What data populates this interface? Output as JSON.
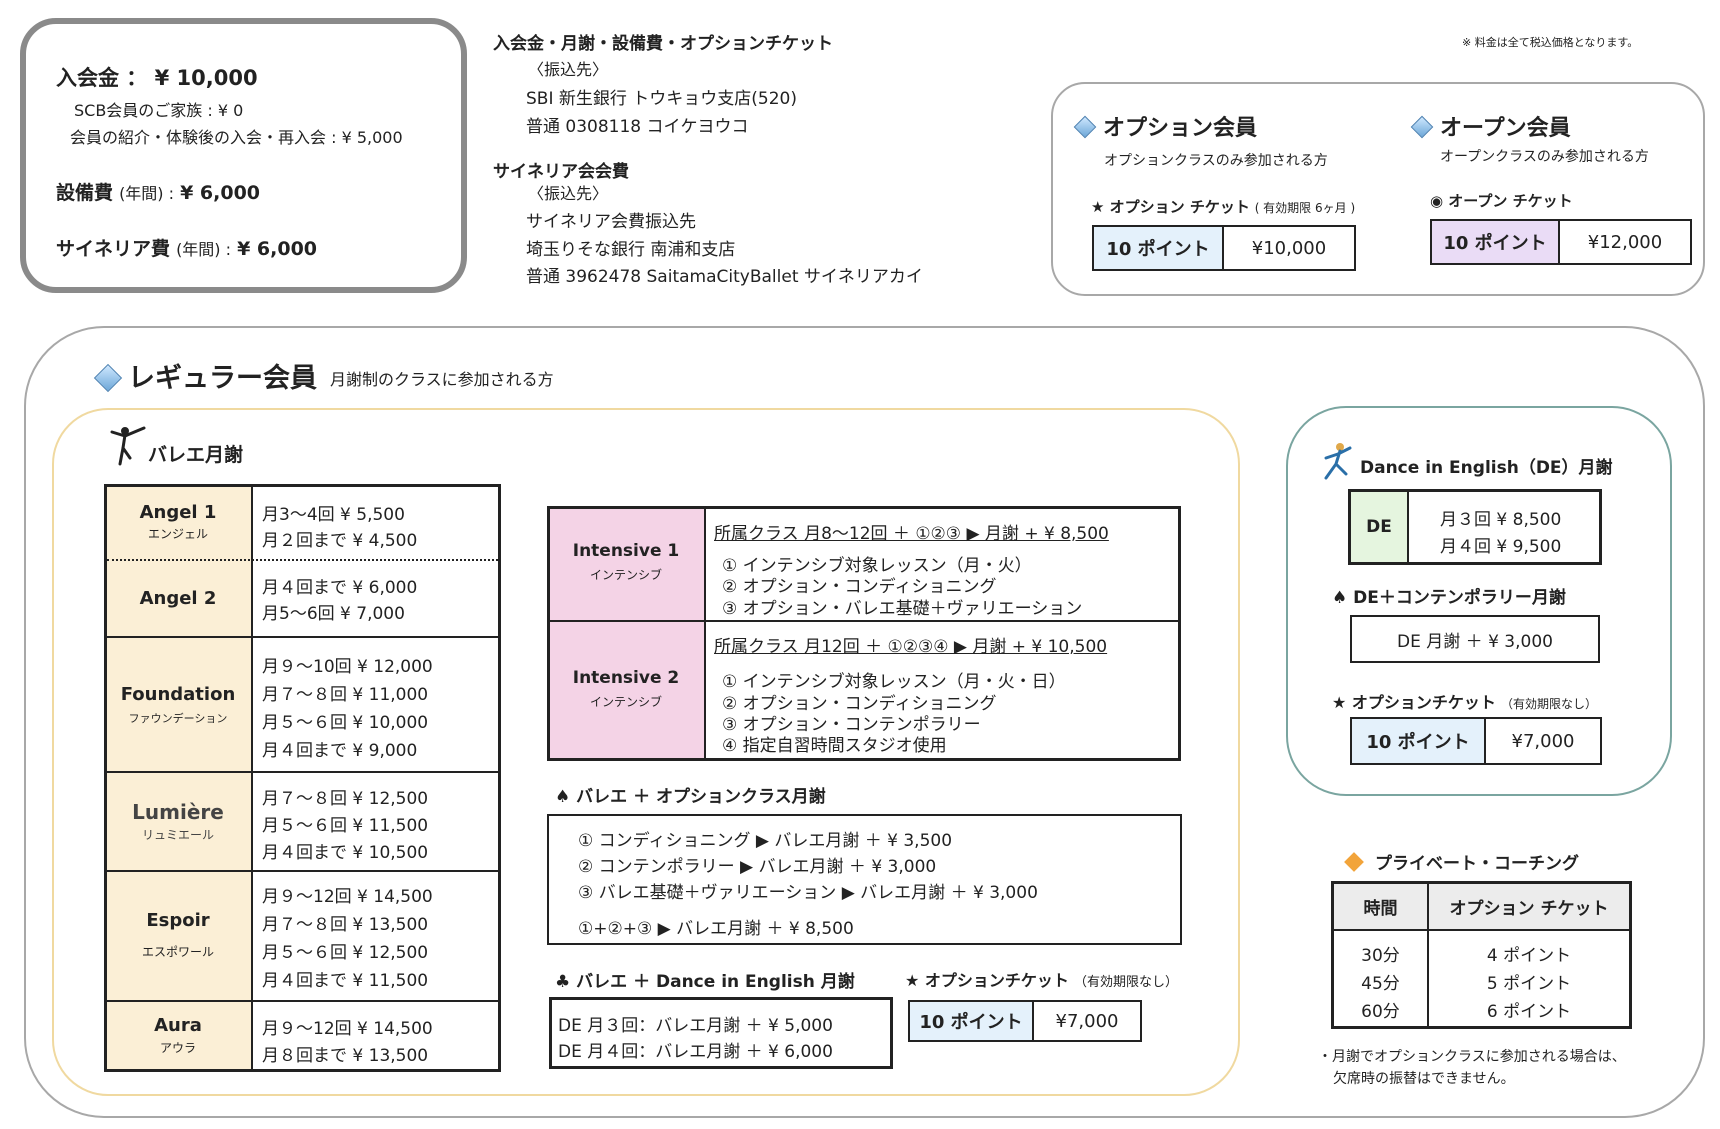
{
  "fees": {
    "entry": "入会金 ： ¥ 10,000",
    "family": "SCB会員のご家族 : ¥ 0",
    "referral": "会員の紹介・体験後の入会・再入会 : ¥ 5,000",
    "equipment_label": "設備費",
    "equipment_period": "(年間) :",
    "equipment_value": "¥ 6,000",
    "sainelia_label": "サイネリア費",
    "sainelia_period": "(年間) :",
    "sainelia_value": "¥ 6,000"
  },
  "transfer": {
    "title1": "入会金・月謝・設備費・オプションチケット",
    "dest1": "〈振込先〉",
    "bank1": "SBI  新生銀行  トウキョウ支店(520)",
    "account1": "普通  0308118  コイケヨウコ",
    "title2": "サイネリア会会費",
    "dest2": "〈振込先〉",
    "payee2": "サイネリア会費振込先",
    "bank2": "埼玉りそな銀行  南浦和支店",
    "account2": "普通  3962478  SaitamaCityBallet  サイネリアカイ"
  },
  "tax_note": "※  料金は全て税込価格となります。",
  "option_member": {
    "title": "オプション会員",
    "desc": "オプションクラスのみ参加される方",
    "ticket_label": "★ オプション チケット",
    "ticket_note": "( 有効期限 6ヶ月 )",
    "points": "10  ポイント",
    "price": "¥10,000"
  },
  "open_member": {
    "title": "オープン会員",
    "desc": "オープンクラスのみ参加される方",
    "ticket_label": "◉  オープン  チケット",
    "points": "10  ポイント",
    "price": "¥12,000"
  },
  "regular": {
    "title": "レギュラー会員",
    "desc": "月謝制のクラスに参加される方"
  },
  "ballet": {
    "title": "バレエ月謝",
    "rows": [
      {
        "name": "Angel  1",
        "kana": "エンジェル",
        "lines": [
          "月3～4回   ¥    5,500",
          "月２回まで  ¥    4,500"
        ]
      },
      {
        "name": "Angel  2",
        "kana": "",
        "lines": [
          "月４回まで   ¥    6,000",
          "月5～6回     ¥    7,000"
        ]
      },
      {
        "name": "Foundation",
        "kana": "ファウンデーション",
        "lines": [
          "月９～10回   ¥ 12,000",
          "月７～８回   ¥ 11,000",
          "月５～６回   ¥ 10,000",
          "月４回まで   ¥    9,000"
        ]
      },
      {
        "name": "Lumière",
        "kana": "リュミエール",
        "lines": [
          "月７～８回   ¥ 12,500",
          "月５～６回   ¥ 11,500",
          "月４回まで   ¥ 10,500"
        ]
      },
      {
        "name": "Espoir",
        "kana": "エスポワール",
        "lines": [
          "月９～12回   ¥ 14,500",
          "月７～８回   ¥ 13,500",
          "月５～６回   ¥ 12,500",
          "月４回まで   ¥ 11,500"
        ]
      },
      {
        "name": "Aura",
        "kana": "アウラ",
        "lines": [
          "月９～12回   ¥ 14,500",
          "月８回まで   ¥ 13,500"
        ]
      }
    ]
  },
  "intensive": [
    {
      "name": "Intensive  1",
      "kana": "インテンシブ",
      "head": "所属クラス  月8～12回  ＋  ①②③  ▶  月謝  +  ¥ 8,500",
      "items": [
        "①  インテンシブ対象レッスン（月・火）",
        "②  オプション・コンディショニング",
        "③  オプション・バレエ基礎＋ヴァリエーション"
      ]
    },
    {
      "name": "Intensive  2",
      "kana": "インテンシブ",
      "head": "所属クラス  月12回  ＋  ①②③④  ▶  月謝  +  ¥ 10,500",
      "items": [
        "①  インテンシブ対象レッスン（月・火・日）",
        "②  オプション・コンディショニング",
        "③  オプション・コンテンポラリー",
        "④  指定自習時間スタジオ使用"
      ]
    }
  ],
  "option_class": {
    "title": "♠  バレエ  ＋ オプションクラス月謝",
    "items": [
      "①  コンディショニング  ▶  バレエ月謝  ＋  ¥ 3,500",
      "②  コンテンポラリー  ▶  バレエ月謝  ＋  ¥ 3,000",
      "③  バレエ基礎＋ヴァリエーション  ▶  バレエ月謝  ＋  ¥ 3,000"
    ],
    "combo": "①+②+③  ▶  バレエ月謝  ＋  ¥ 8,500"
  },
  "ballet_de": {
    "title": "♣  バレエ  ＋ Dance in English 月謝",
    "lines": [
      "DE  月３回：バレエ月謝  ＋  ¥ 5,000",
      "DE  月４回：バレエ月謝  ＋  ¥ 6,000"
    ]
  },
  "option_ticket_mid": {
    "label": "★  オプションチケット",
    "note": "（有効期限なし）",
    "points": "10  ポイント",
    "price": "¥7,000"
  },
  "de": {
    "title": "Dance in English（DE）月謝",
    "code": "DE",
    "lines": [
      "月３回   ¥ 8,500",
      "月４回   ¥ 9,500"
    ],
    "contemporary_title": "♠  DE＋コンテンポラリー月謝",
    "contemporary_value": "DE  月謝  ＋  ¥ 3,000",
    "ticket_label": "★  オプションチケット",
    "ticket_note": "（有効期限なし）",
    "points": "10  ポイント",
    "price": "¥7,000"
  },
  "private": {
    "title": "プライベート・コーチング",
    "col1": "時間",
    "col2": "オプション  チケット",
    "times": [
      "30分",
      "45分",
      "60分"
    ],
    "points": [
      "4  ポイント",
      "5  ポイント",
      "6  ポイント"
    ]
  },
  "footnote": [
    "・月謝でオプションクラスに参加される場合は、",
    "欠席時の振替はできません。"
  ],
  "colors": {
    "cream": "#fbefd6",
    "pink": "#f4d3e6",
    "lightblue": "#e4f1fb",
    "lavender": "#eadcf6",
    "mint": "#e5f5df",
    "gray": "#ececec",
    "teal": "#7aa5a0",
    "gold": "#f0d9a0"
  }
}
